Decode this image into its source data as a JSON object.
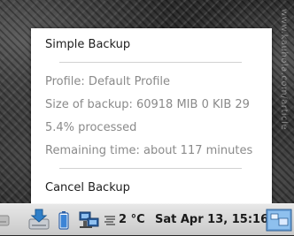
{
  "watermark": "www.kauhola.com/article",
  "menu": {
    "items": {
      "simple_backup": "Simple Backup",
      "cancel_backup": "Cancel Backup"
    },
    "info": {
      "profile": "Profile: Default Profile",
      "size": "Size of backup: 60918 MIB 0 KIB 29",
      "processed": "5.4% processed",
      "remaining": "Remaining time: about 117 minutes"
    }
  },
  "panel": {
    "temperature": "2 °C",
    "clock": "Sat Apr 13, 15:16",
    "icons": [
      "disk-icon",
      "backup-icon",
      "battery-icon",
      "network-icon",
      "weather-icon",
      "workspace-icon"
    ]
  },
  "colors": {
    "menu_bg": "#ffffff",
    "menu_text": "#1e1e1e",
    "info_text": "#8a8a8a",
    "panel_bg": "#d8d8d8",
    "backup_icon": "#2f7fc8"
  }
}
